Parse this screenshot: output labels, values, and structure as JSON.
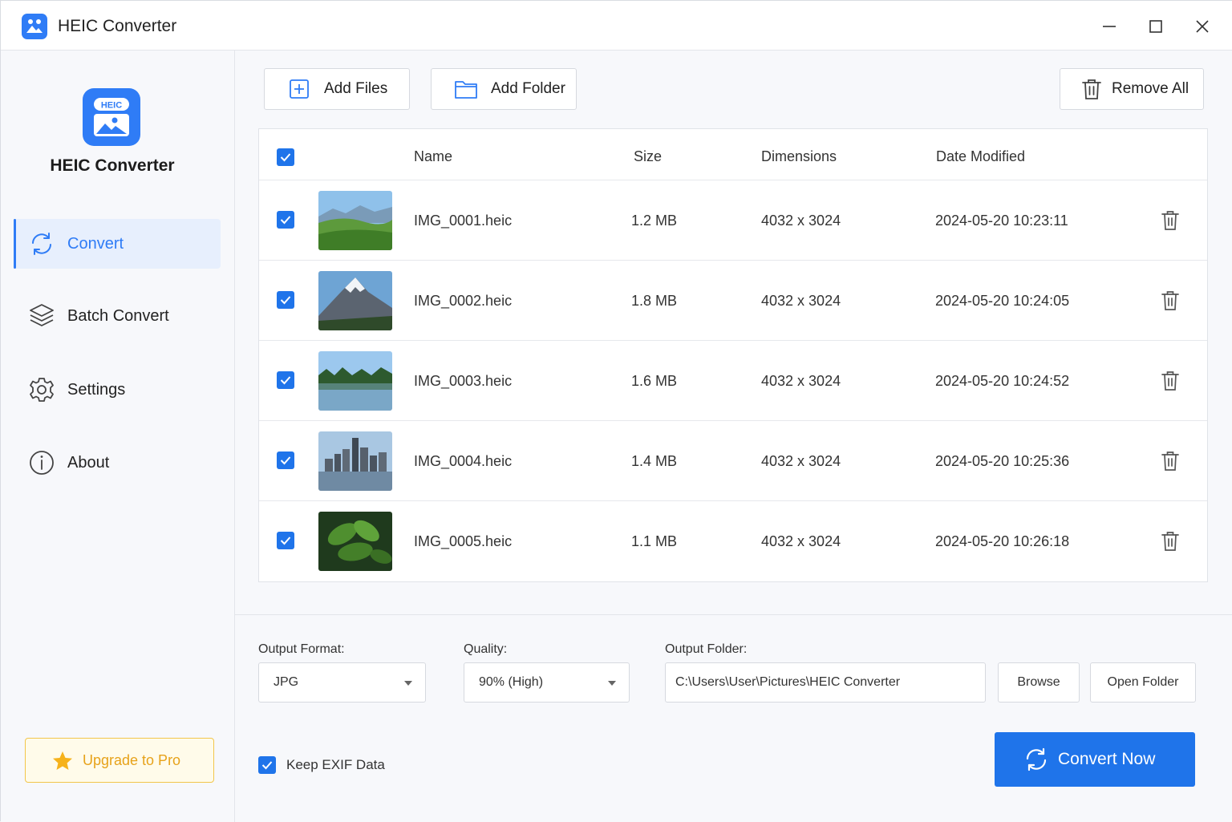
{
  "window": {
    "title": "HEIC Converter"
  },
  "sidebar": {
    "logo_badge": "HEIC",
    "app_name": "HEIC Converter",
    "items": [
      {
        "label": "Convert",
        "icon": "refresh-icon",
        "active": true
      },
      {
        "label": "Batch Convert",
        "icon": "layers-icon",
        "active": false
      },
      {
        "label": "Settings",
        "icon": "gear-icon",
        "active": false
      },
      {
        "label": "About",
        "icon": "info-icon",
        "active": false
      }
    ],
    "upgrade_label": "Upgrade to Pro"
  },
  "toolbar": {
    "add_files": "Add Files",
    "add_folder": "Add Folder",
    "remove_all": "Remove All"
  },
  "table": {
    "columns": [
      "Name",
      "Size",
      "Dimensions",
      "Date Modified"
    ],
    "rows": [
      {
        "checked": true,
        "thumb": "green-hills",
        "name": "IMG_0001.heic",
        "size": "1.2 MB",
        "dimensions": "4032 x 3024",
        "date": "2024-05-20 10:23:11"
      },
      {
        "checked": true,
        "thumb": "snowy-mountain",
        "name": "IMG_0002.heic",
        "size": "1.8 MB",
        "dimensions": "4032 x 3024",
        "date": "2024-05-20 10:24:05"
      },
      {
        "checked": true,
        "thumb": "lake-forest",
        "name": "IMG_0003.heic",
        "size": "1.6 MB",
        "dimensions": "4032 x 3024",
        "date": "2024-05-20 10:24:52"
      },
      {
        "checked": true,
        "thumb": "city-skyline",
        "name": "IMG_0004.heic",
        "size": "1.4 MB",
        "dimensions": "4032 x 3024",
        "date": "2024-05-20 10:25:36"
      },
      {
        "checked": true,
        "thumb": "green-leaves",
        "name": "IMG_0005.heic",
        "size": "1.1 MB",
        "dimensions": "4032 x 3024",
        "date": "2024-05-20 10:26:18"
      }
    ]
  },
  "settings": {
    "output_format_label": "Output Format:",
    "output_format_value": "JPG",
    "quality_label": "Quality:",
    "quality_value": "90% (High)",
    "output_folder_label": "Output Folder:",
    "output_folder_value": "C:\\Users\\User\\Pictures\\HEIC Converter",
    "browse": "Browse",
    "open_folder": "Open Folder",
    "keep_exif_label": "Keep EXIF Data",
    "keep_exif_checked": true,
    "convert_now": "Convert Now"
  },
  "colors": {
    "accent": "#1f74ea",
    "upgrade": "#e7a21a"
  }
}
